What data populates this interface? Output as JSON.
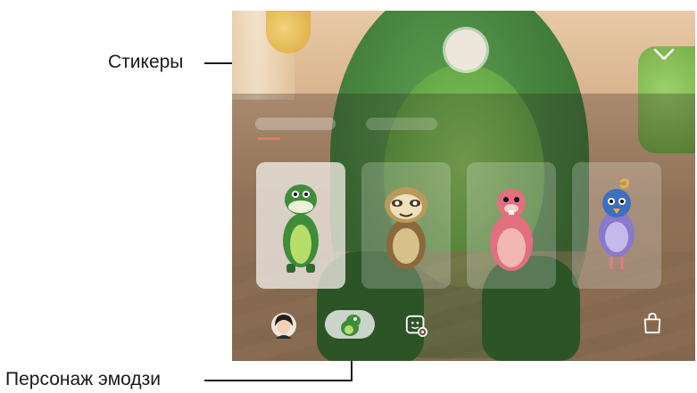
{
  "callouts": {
    "stickers_label": "Стикеры",
    "emoji_character_label": "Персонаж эмодзи"
  },
  "camera": {
    "tabs": [
      {
        "label": "",
        "selected": true
      },
      {
        "label": "",
        "selected": false
      }
    ],
    "characters": [
      {
        "name": "green-dinosaur",
        "selected": true
      },
      {
        "name": "sloth",
        "selected": false
      },
      {
        "name": "pink-creature",
        "selected": false
      },
      {
        "name": "purple-bird",
        "selected": false
      }
    ],
    "bottom_bar": {
      "items": [
        "avatar-icon",
        "emoji-character-icon",
        "sticker-settings-icon",
        "store-bag-icon"
      ]
    },
    "colors": {
      "accent": "#e8766a",
      "dino_green": "#3c7f39"
    }
  }
}
